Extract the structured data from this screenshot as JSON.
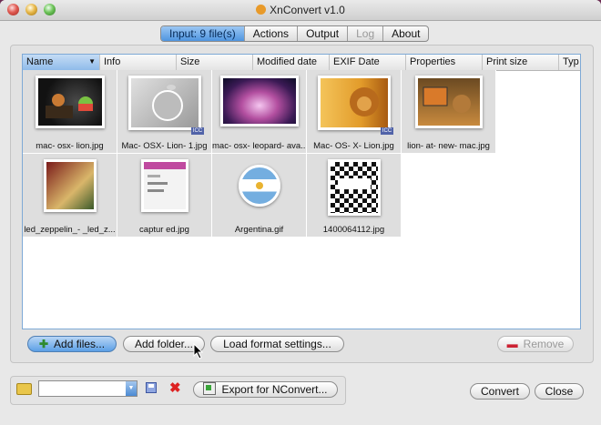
{
  "window": {
    "title": "XnConvert v1.0"
  },
  "tabs": [
    {
      "label": "Input: 9 file(s)"
    },
    {
      "label": "Actions"
    },
    {
      "label": "Output"
    },
    {
      "label": "Log"
    },
    {
      "label": "About"
    }
  ],
  "list": {
    "columns": [
      "Name",
      "Info",
      "Size",
      "Modified date",
      "EXIF Date",
      "Properties",
      "Print size",
      "Typ"
    ],
    "files": [
      {
        "name": "mac- osx- lion.jpg",
        "icc": false
      },
      {
        "name": "Mac- OSX- Lion- 1.jpg",
        "icc": true,
        "icc_label": "ICC"
      },
      {
        "name": "mac- osx- leopard- ava...",
        "icc": false
      },
      {
        "name": "Mac- OS- X- Lion.jpg",
        "icc": true,
        "icc_label": "ICC"
      },
      {
        "name": "lion- at- new- mac.jpg",
        "icc": false
      },
      {
        "name": "led_zeppelin_- _led_z...",
        "icc": false
      },
      {
        "name": "captur ed.jpg",
        "icc": false
      },
      {
        "name": "Argentina.gif",
        "icc": false
      },
      {
        "name": "1400064112.jpg",
        "icc": false
      }
    ]
  },
  "buttons": {
    "add_files": "Add files...",
    "add_folder": "Add folder...",
    "load_format": "Load format settings...",
    "remove": "Remove",
    "export": "Export for NConvert...",
    "convert": "Convert",
    "close": "Close"
  },
  "preset_combo": {
    "value": ""
  }
}
